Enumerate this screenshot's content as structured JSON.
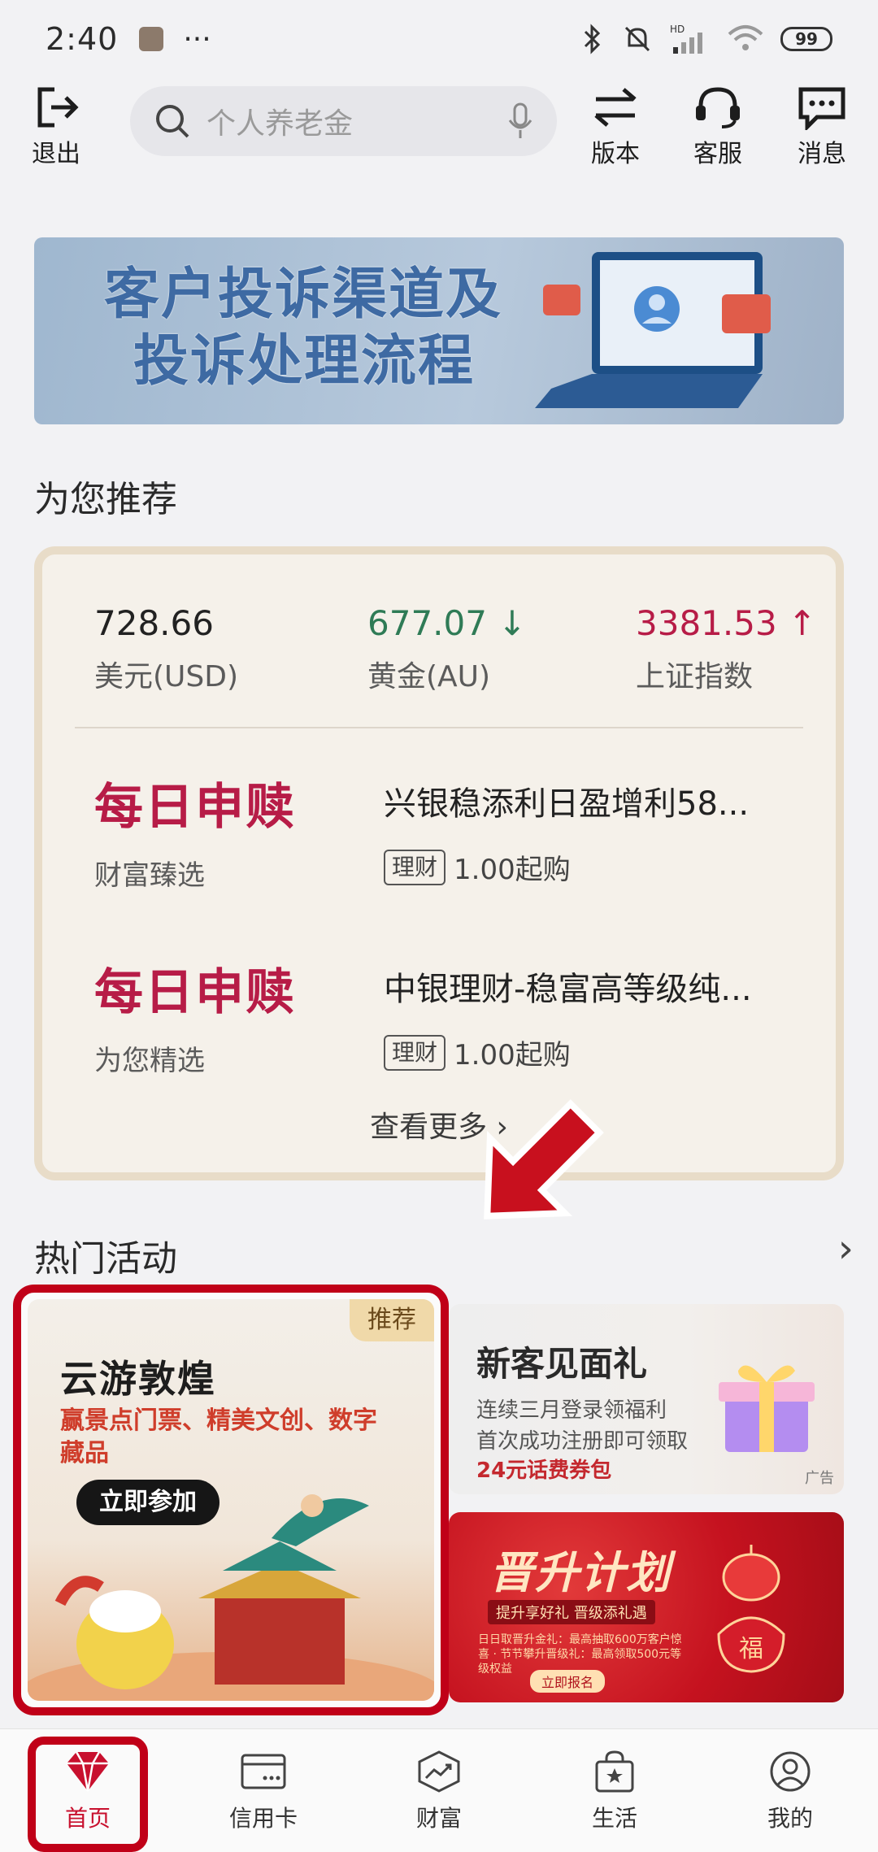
{
  "status_bar": {
    "time": "2:40",
    "dots": "···",
    "battery": "99",
    "signal_label": "HD"
  },
  "top_bar": {
    "exit_label": "退出",
    "search_placeholder": "个人养老金",
    "version_label": "版本",
    "service_label": "客服",
    "message_label": "消息"
  },
  "banner": {
    "line1": "客户投诉渠道及",
    "line2": "投诉处理流程"
  },
  "recommend": {
    "title": "为您推荐",
    "quotes": [
      {
        "value": "728.66",
        "label": "美元(USD)",
        "trend": ""
      },
      {
        "value": "677.07 ↓",
        "label": "黄金(AU)",
        "trend": "down"
      },
      {
        "value": "3381.53 ↑",
        "label": "上证指数",
        "trend": "up"
      }
    ],
    "products": [
      {
        "tag": "每日申赎",
        "sub": "财富臻选",
        "name": "兴银稳添利日盈增利58...",
        "chip": "理财",
        "min": "1.00起购"
      },
      {
        "tag": "每日申赎",
        "sub": "为您精选",
        "name": "中银理财-稳富高等级纯...",
        "chip": "理财",
        "min": "1.00起购"
      }
    ],
    "more_label": "查看更多 ›"
  },
  "activities": {
    "title": "热门活动",
    "chevron": "›",
    "main": {
      "badge": "推荐",
      "title": "云游敦煌",
      "desc": "赢景点门票、精美文创、数字藏品",
      "button": "立即参加"
    },
    "card1": {
      "title": "新客见面礼",
      "line1": "连续三月登录领福利",
      "line2": "首次成功注册即可领取",
      "line3": "24元话费券包",
      "ad": "广告"
    },
    "card2": {
      "title": "晋升计划",
      "slogan": "提升享好礼 晋级添礼遇",
      "detail": "日日取晋升金礼：最高抽取600万客户惊喜 · 节节攀升晋级礼：最高领取500元等级权益",
      "cta": "立即报名",
      "fu": "福"
    }
  },
  "bottom_nav": [
    {
      "label": "首页"
    },
    {
      "label": "信用卡"
    },
    {
      "label": "财富"
    },
    {
      "label": "生活"
    },
    {
      "label": "我的"
    }
  ]
}
